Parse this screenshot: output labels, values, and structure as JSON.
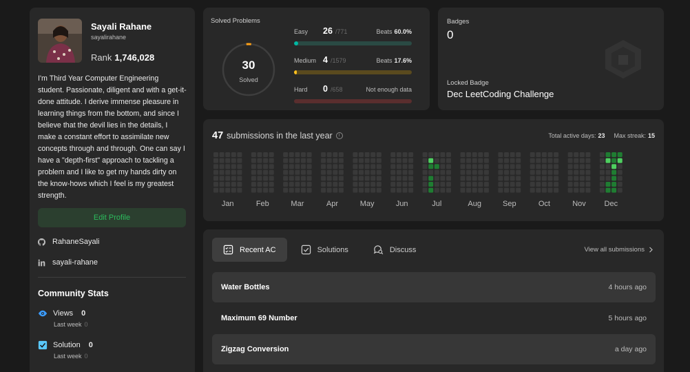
{
  "profile": {
    "name": "Sayali Rahane",
    "username": "sayalirahane",
    "rank_label": "Rank",
    "rank": "1,746,028",
    "bio": "I'm Third Year Computer Engineering student. Passionate, diligent and with a get-it-done attitude. I derive immense pleasure in learning things from the bottom, and since I believe that the devil lies in the details, I make a constant effort to assimilate new concepts through and through. One can say I have a \"depth-first\" approach to tackling a problem and I like to get my hands dirty on the know-hows which I feel is my greatest strength.",
    "edit_label": "Edit Profile",
    "github": "RahaneSayali",
    "linkedin": "sayali-rahane"
  },
  "community": {
    "title": "Community Stats",
    "views_label": "Views",
    "views": "0",
    "views_week_label": "Last week",
    "views_week": "0",
    "solution_label": "Solution",
    "solution": "0",
    "solution_week_label": "Last week",
    "solution_week": "0"
  },
  "solved": {
    "title": "Solved Problems",
    "total": "30",
    "total_label": "Solved",
    "easy": {
      "label": "Easy",
      "count": "26",
      "total": "/771",
      "beats_label": "Beats",
      "beats": "60.0%",
      "fraction": 0.0337
    },
    "medium": {
      "label": "Medium",
      "count": "4",
      "total": "/1579",
      "beats_label": "Beats",
      "beats": "17.6%",
      "fraction": 0.0025
    },
    "hard": {
      "label": "Hard",
      "count": "0",
      "total": "/658",
      "beats_text": "Not enough data",
      "fraction": 0
    }
  },
  "badges": {
    "title": "Badges",
    "count": "0",
    "locked_label": "Locked Badge",
    "locked_name": "Dec LeetCoding Challenge"
  },
  "submissions": {
    "count": "47",
    "label": "submissions in the last year",
    "active_label": "Total active days:",
    "active": "23",
    "streak_label": "Max streak:",
    "streak": "15",
    "months": [
      "Jan",
      "Feb",
      "Mar",
      "Apr",
      "May",
      "Jun",
      "Jul",
      "Aug",
      "Sep",
      "Oct",
      "Nov",
      "Dec"
    ]
  },
  "recent": {
    "tabs": [
      "Recent AC",
      "Solutions",
      "Discuss"
    ],
    "view_all": "View all submissions",
    "items": [
      {
        "title": "Water Bottles",
        "time": "4 hours ago"
      },
      {
        "title": "Maximum 69 Number",
        "time": "5 hours ago"
      },
      {
        "title": "Zigzag Conversion",
        "time": "a day ago"
      }
    ]
  },
  "colors": {
    "easy": "#00b8a3",
    "medium": "#ffc01e",
    "hard": "#ef4743",
    "accent_green": "#2cbb5d"
  }
}
